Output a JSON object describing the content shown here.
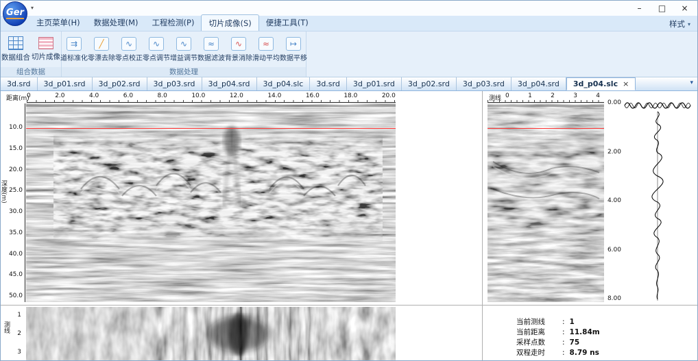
{
  "window": {
    "logo": "Ger",
    "quick_caret": "▾",
    "controls": {
      "minimize": "–",
      "maximize": "□",
      "close": "×"
    }
  },
  "menu": {
    "tabs": [
      "主页菜单(H)",
      "数据处理(M)",
      "工程检测(P)",
      "切片成像(S)",
      "便捷工具(T)"
    ],
    "active_tab": "切片成像(S)",
    "style_button": {
      "label": "样式",
      "caret": "▾"
    }
  },
  "ribbon": {
    "groups": [
      {
        "caption": "组合数据"
      },
      {
        "caption": "数据处理"
      }
    ],
    "big_buttons": [
      {
        "label": "数据组合",
        "icon": "grid-icon"
      },
      {
        "label": "切片成像",
        "icon": "slices-icon"
      }
    ],
    "tool_buttons": [
      {
        "label": "道标准化",
        "glyph": "⇉"
      },
      {
        "label": "零漂去除",
        "glyph": "╱"
      },
      {
        "label": "零点校正",
        "glyph": "∿"
      },
      {
        "label": "零点调节",
        "glyph": "∿"
      },
      {
        "label": "增益调节",
        "glyph": "∿"
      },
      {
        "label": "数据滤波",
        "glyph": "≈"
      },
      {
        "label": "背景消除",
        "glyph": "∿"
      },
      {
        "label": "滑动平均",
        "glyph": "≈"
      },
      {
        "label": "数据平移",
        "glyph": "↦"
      }
    ]
  },
  "file_tabs": {
    "inactive": [
      "3d.srd",
      "3d_p01.srd",
      "3d_p02.srd",
      "3d_p03.srd",
      "3d_p04.srd",
      "3d_p04.slc",
      "3d.srd",
      "3d_p01.srd",
      "3d_p02.srd",
      "3d_p03.srd",
      "3d_p04.srd"
    ],
    "active": {
      "label": "3d_p04.slc",
      "close": "×"
    },
    "corner_caret": "▾"
  },
  "panels": {
    "cursor_color": "#ff3333",
    "main": {
      "x_label": "距离(m)",
      "x_ticks": [
        "0",
        "2.0",
        "4.0",
        "6.0",
        "8.0",
        "10.0",
        "12.0",
        "14.0",
        "16.0",
        "18.0",
        "20.0"
      ],
      "y_label": "深度(m)",
      "y_ticks": [
        "10.0",
        "15.0",
        "20.0",
        "25.0",
        "30.0",
        "35.0",
        "40.0",
        "45.0",
        "50.0"
      ]
    },
    "cross": {
      "x_label": "测线",
      "x_ticks": [
        "0",
        "1",
        "2",
        "3",
        "4"
      ]
    },
    "trace": {
      "y_ticks": [
        "0.00",
        "2.00",
        "4.00",
        "6.00",
        "8.00"
      ]
    },
    "plan": {
      "y_label": "测线",
      "y_ticks": [
        "1",
        "2",
        "3"
      ]
    },
    "info": {
      "separator": ":",
      "rows": [
        {
          "label": "当前测线",
          "value": "1"
        },
        {
          "label": "当前距离",
          "value": "11.84m"
        },
        {
          "label": "采样点数",
          "value": "75"
        },
        {
          "label": "双程走时",
          "value": "8.79 ns"
        }
      ]
    }
  }
}
